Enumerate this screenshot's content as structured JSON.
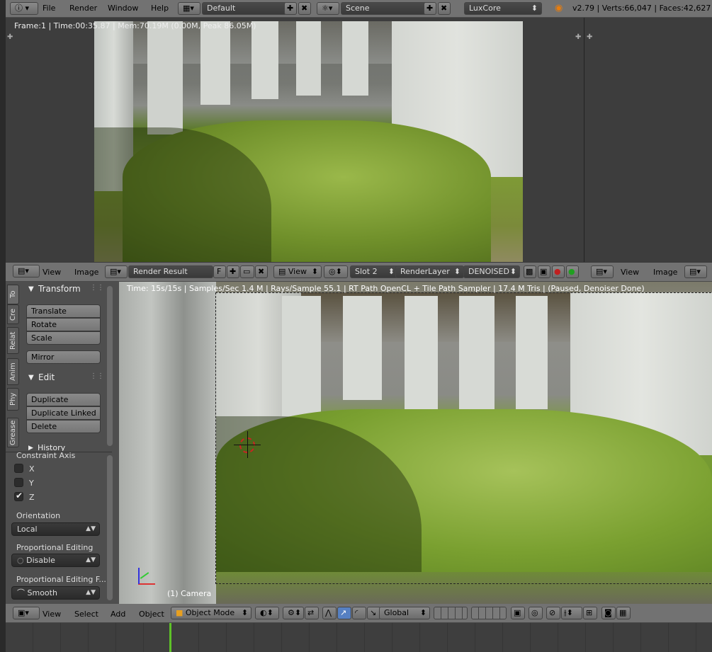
{
  "top_bar": {
    "menus": [
      "File",
      "Render",
      "Window",
      "Help"
    ],
    "layout": "Default",
    "scene": "Scene",
    "engine": "LuxCore",
    "stats": "v2.79 | Verts:66,047 | Faces:42,627 |"
  },
  "render_view": {
    "info": "Frame:1 | Time:00:35.87 | Mem:70.19M (0.00M, Peak 86.05M)"
  },
  "image_header": {
    "menus": [
      "View",
      "Image"
    ],
    "image_name": "Render Result",
    "fake_user": "F",
    "view_menu": "View",
    "slot": "Slot 2",
    "layer": "RenderLayer",
    "pass": "DENOISED",
    "right_menus": [
      "View",
      "Image"
    ]
  },
  "viewport": {
    "status": "Time: 15s/15s | Samples/Sec 1.4 M | Rays/Sample 55.1 | RT Path OpenCL + Tile Path Sampler | 17.4 M Tris | (Paused, Denoiser Done)",
    "camera_label": "(1) Camera"
  },
  "tool_tabs": [
    "To",
    "Cre",
    "Relat",
    "Anim",
    "Phy",
    "Grease"
  ],
  "transform": {
    "title": "Transform",
    "buttons": [
      "Translate",
      "Rotate",
      "Scale"
    ],
    "mirror": "Mirror"
  },
  "edit": {
    "title": "Edit",
    "buttons": [
      "Duplicate",
      "Duplicate Linked",
      "Delete"
    ]
  },
  "history": {
    "title": "History"
  },
  "operator": {
    "constraint_axis": "Constraint Axis",
    "axes": [
      {
        "label": "X",
        "checked": false
      },
      {
        "label": "Y",
        "checked": false
      },
      {
        "label": "Z",
        "checked": true
      }
    ],
    "orientation_label": "Orientation",
    "orientation": "Local",
    "prop_edit_label": "Proportional Editing",
    "prop_edit": "Disable",
    "prop_falloff_label": "Proportional Editing F...",
    "prop_falloff": "Smooth"
  },
  "bottom_header": {
    "menus": [
      "View",
      "Select",
      "Add",
      "Object"
    ],
    "mode": "Object Mode",
    "orientation": "Global"
  }
}
